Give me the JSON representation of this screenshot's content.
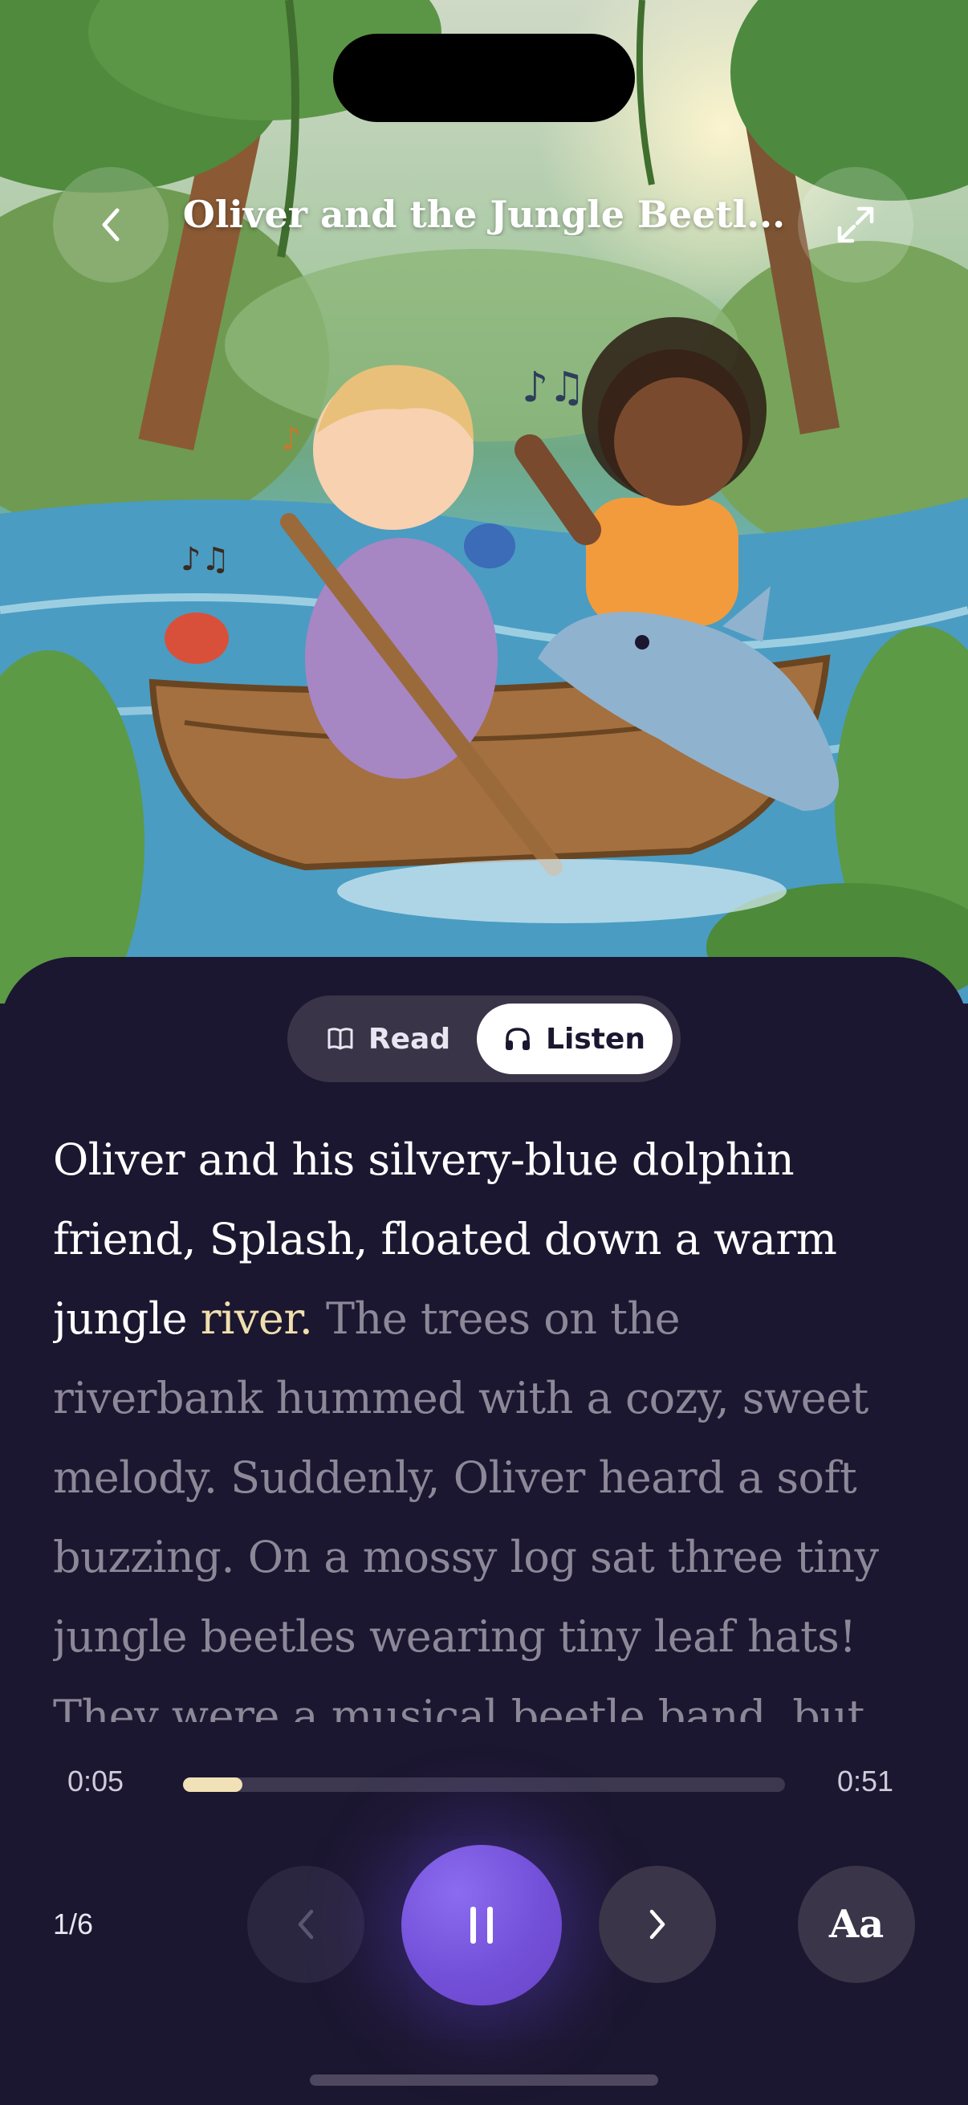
{
  "header": {
    "title": "Oliver and the Jungle Beetl...",
    "back_icon": "chevron-left-icon",
    "expand_icon": "expand-icon"
  },
  "mode_toggle": {
    "read_label": "Read",
    "listen_label": "Listen",
    "selected": "Listen"
  },
  "story": {
    "lines": [
      [
        {
          "t": "Oliver and his silvery-blue dolphin",
          "s": "read"
        }
      ],
      [
        {
          "t": "friend, Splash, floated down a warm",
          "s": "read"
        }
      ],
      [
        {
          "t": "jungle ",
          "s": "read"
        },
        {
          "t": "river.",
          "s": "current"
        },
        {
          "t": " The trees on the",
          "s": "unread"
        }
      ],
      [
        {
          "t": "riverbank hummed with a cozy, sweet",
          "s": "unread"
        }
      ],
      [
        {
          "t": "melody. Suddenly, Oliver heard a soft",
          "s": "unread"
        }
      ],
      [
        {
          "t": "buzzing. On a mossy log sat three tiny",
          "s": "unread"
        }
      ],
      [
        {
          "t": "jungle beetles wearing tiny leaf hats!",
          "s": "unread"
        }
      ],
      [
        {
          "t": "They were a musical beetle band, but",
          "s": "unread"
        }
      ]
    ]
  },
  "player": {
    "current_time": "0:05",
    "total_time": "0:51",
    "progress_fraction": 0.098,
    "page": "1/6",
    "font_label": "Aa",
    "colors": {
      "accent": "#7350d8",
      "highlight": "#f0dfae",
      "background": "#1c1730"
    }
  }
}
